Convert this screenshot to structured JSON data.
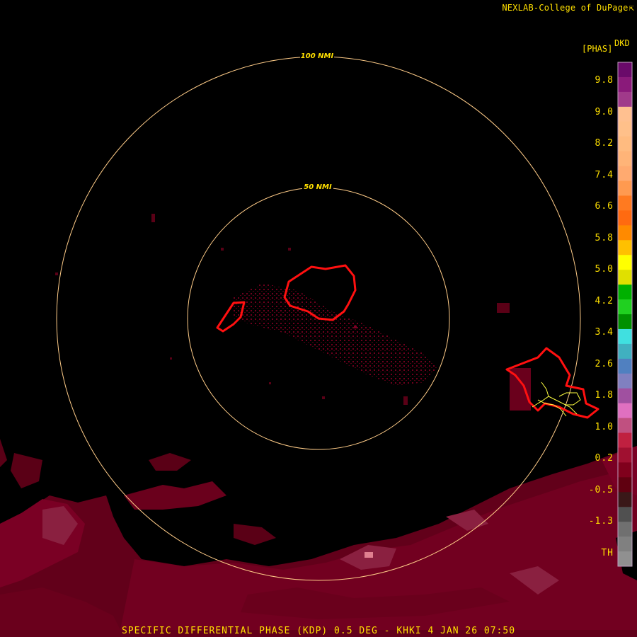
{
  "credit": "NEXLAB-College of DuPage",
  "credit_icon": "external-link-icon",
  "footer_caption": "SPECIFIC DIFFERENTIAL PHASE (KDP) 0.5 DEG - KHKI 4 JAN 26 07:50",
  "range_rings": [
    {
      "label": "100 NMI"
    },
    {
      "label": "50 NMI"
    }
  ],
  "color_scale": {
    "unit": "[PHAS]",
    "product": "DKD",
    "ticks": [
      "9.8",
      "9.0",
      "8.2",
      "7.4",
      "6.6",
      "5.8",
      "5.0",
      "4.2",
      "3.4",
      "2.6",
      "1.8",
      "1.0",
      "0.2",
      "-0.5",
      "-1.3",
      "TH"
    ],
    "colors": [
      "#6a0a6a",
      "#8a1a7a",
      "#a03a8a",
      "#ffc090",
      "#ffc08a",
      "#ffbb80",
      "#ffb478",
      "#ffaa70",
      "#ff9a50",
      "#ff7a20",
      "#ff6a10",
      "#ff8a00",
      "#ffc000",
      "#ffff00",
      "#e0e000",
      "#00b000",
      "#20d020",
      "#009000",
      "#40e0e0",
      "#40b0c0",
      "#5080c0",
      "#8080c0",
      "#a050a0",
      "#e070c0",
      "#c05080",
      "#c02040",
      "#a01030",
      "#80001c",
      "#600010",
      "#3a1818",
      "#505050",
      "#707070",
      "#808080",
      "#909090"
    ],
    "ring_color": "#ffcc88",
    "storm_outline_color": "#ff1010",
    "lightning_color": "#ffff40",
    "echo_color": "#6a0018"
  }
}
